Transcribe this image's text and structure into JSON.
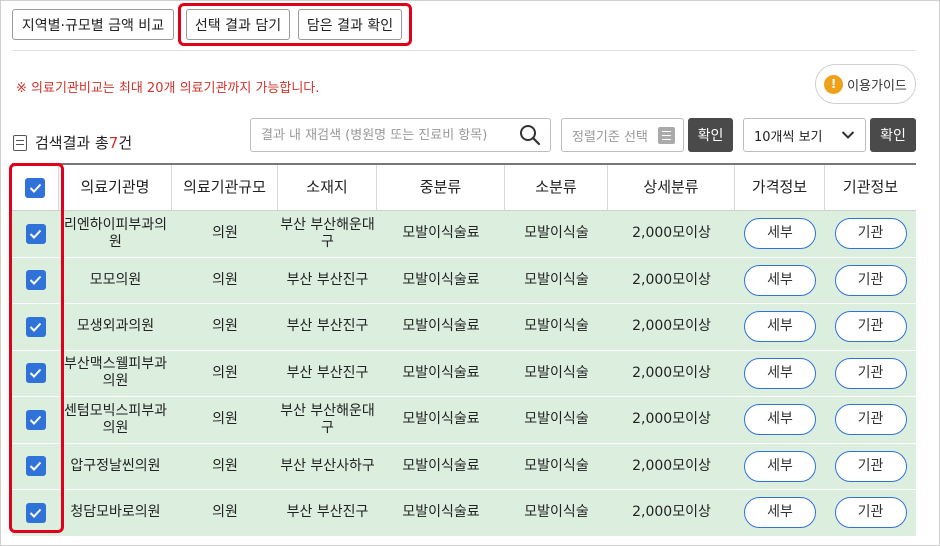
{
  "top_buttons": {
    "region_compare": "지역별·규모별 금액 비교",
    "add_selected": "선택 결과 담기",
    "check_saved": "담은 결과 확인"
  },
  "notice": "※ 의료기관비교는 최대 20개 의료기관까지 가능합니다.",
  "guide_button": "이용가이드",
  "result": {
    "prefix": "검색결과 총",
    "count": "7",
    "suffix": "건"
  },
  "search": {
    "placeholder": "결과 내 재검색 (병원명 또는 진료비 항목)",
    "value": ""
  },
  "sort": {
    "placeholder": "정렬기준 선택"
  },
  "confirm_label": "확인",
  "per_page": {
    "selected": "10개씩 보기"
  },
  "table": {
    "headers": [
      "의료기관명",
      "의료기관규모",
      "소재지",
      "중분류",
      "소분류",
      "상세분류",
      "가격정보",
      "기관정보"
    ],
    "rows": [
      {
        "name": "리엔하이피부과의원",
        "size": "의원",
        "location": "부산 부산해운대구",
        "mid": "모발이식술료",
        "sub": "모발이식술",
        "detail": "2,000모이상",
        "price_btn": "세부",
        "inst_btn": "기관"
      },
      {
        "name": "모모의원",
        "size": "의원",
        "location": "부산 부산진구",
        "mid": "모발이식술료",
        "sub": "모발이식술",
        "detail": "2,000모이상",
        "price_btn": "세부",
        "inst_btn": "기관"
      },
      {
        "name": "모생외과의원",
        "size": "의원",
        "location": "부산 부산진구",
        "mid": "모발이식술료",
        "sub": "모발이식술",
        "detail": "2,000모이상",
        "price_btn": "세부",
        "inst_btn": "기관"
      },
      {
        "name": "부산맥스웰피부과의원",
        "size": "의원",
        "location": "부산 부산진구",
        "mid": "모발이식술료",
        "sub": "모발이식술",
        "detail": "2,000모이상",
        "price_btn": "세부",
        "inst_btn": "기관"
      },
      {
        "name": "센텀모빅스피부과의원",
        "size": "의원",
        "location": "부산 부산해운대구",
        "mid": "모발이식술료",
        "sub": "모발이식술",
        "detail": "2,000모이상",
        "price_btn": "세부",
        "inst_btn": "기관"
      },
      {
        "name": "압구정날씬의원",
        "size": "의원",
        "location": "부산 부산사하구",
        "mid": "모발이식술료",
        "sub": "모발이식술",
        "detail": "2,000모이상",
        "price_btn": "세부",
        "inst_btn": "기관"
      },
      {
        "name": "청담모바로의원",
        "size": "의원",
        "location": "부산 부산진구",
        "mid": "모발이식술료",
        "sub": "모발이식술",
        "detail": "2,000모이상",
        "price_btn": "세부",
        "inst_btn": "기관"
      }
    ]
  },
  "colors": {
    "accent_red": "#e0001a",
    "checkbox_blue": "#2f72d8",
    "row_green": "#dcefde",
    "dark_button": "#4a4a4a"
  }
}
